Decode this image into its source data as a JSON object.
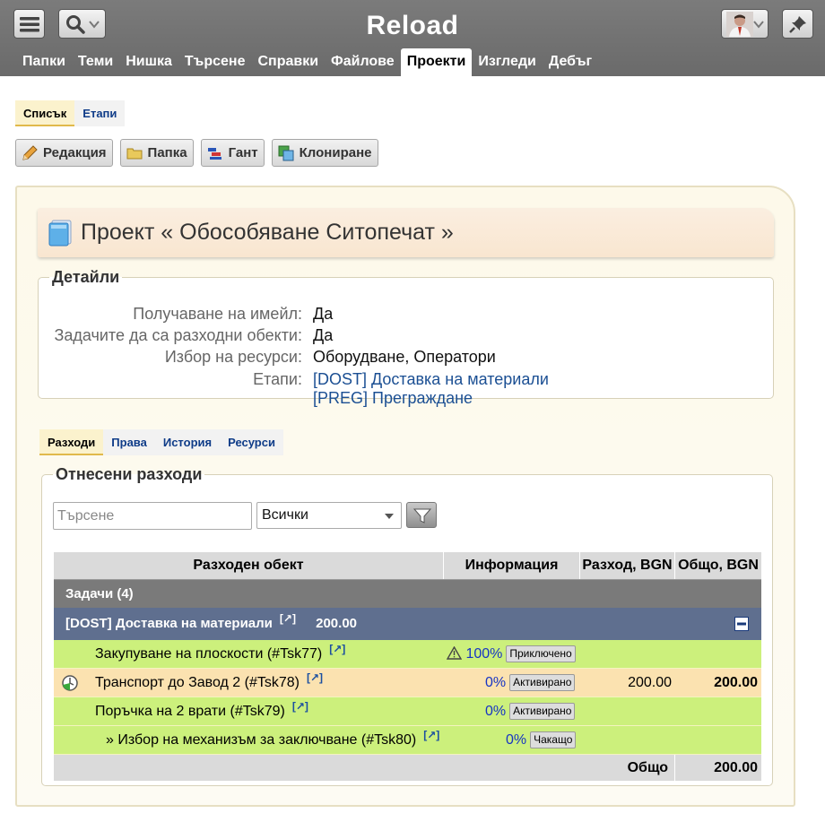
{
  "app": {
    "title": "Reload",
    "nav": [
      "Папки",
      "Теми",
      "Нишка",
      "Търсене",
      "Справки",
      "Файлове",
      "Проекти",
      "Изгледи",
      "Дебъг"
    ],
    "active_nav": "Проекти"
  },
  "subtabs": [
    {
      "label": "Списък",
      "active": true
    },
    {
      "label": "Етапи",
      "active": false
    }
  ],
  "actions": {
    "edit": "Редакция",
    "folder": "Папка",
    "gantt": "Гант",
    "clone": "Клониране"
  },
  "project": {
    "title": "Проект « Обособяване Ситопечат »"
  },
  "details": {
    "legend": "Детайли",
    "rows": [
      {
        "label": "Получаване на имейл:",
        "value": "Да"
      },
      {
        "label": "Задачите да са разходни обекти:",
        "value": "Да"
      },
      {
        "label": "Избор на ресурси:",
        "value": "Оборудване, Оператори"
      },
      {
        "label": "Етапи:",
        "links": [
          "[DOST] Доставка на материали",
          "[PREG] Преграждане"
        ]
      }
    ]
  },
  "tabs2": [
    {
      "label": "Разходи",
      "active": true
    },
    {
      "label": "Права",
      "active": false
    },
    {
      "label": "История",
      "active": false
    },
    {
      "label": "Ресурси",
      "active": false
    }
  ],
  "costs": {
    "legend": "Отнесени разходи",
    "search_placeholder": "Търсене",
    "filter_value": "Всички",
    "columns": [
      "Разходен обект",
      "Информация",
      "Разход, BGN",
      "Общо, BGN"
    ],
    "group_title": "Задачи (4)",
    "subgroup": {
      "title": "[DOST] Доставка на материали",
      "link": "[↗]",
      "amount": "200.00"
    },
    "rows": [
      {
        "name": "Закупуване на плоскости (#Tsk77)",
        "link": "[↗]",
        "pct": "100%",
        "status": "Приключено",
        "warning": true
      },
      {
        "name": "Транспорт до Завод 2 (#Tsk78)",
        "link": "[↗]",
        "pct": "0%",
        "status": "Активирано",
        "cost": "200.00",
        "total": "200.00"
      },
      {
        "name": "Поръчка на 2 врати (#Tsk79)",
        "link": "[↗]",
        "pct": "0%",
        "status": "Активирано"
      },
      {
        "name": "» Избор на механизъм за заключване (#Tsk80)",
        "link": "[↗]",
        "pct": "0%",
        "status": "Чакащо"
      }
    ],
    "total_label": "Общо",
    "total_value": "200.00"
  }
}
